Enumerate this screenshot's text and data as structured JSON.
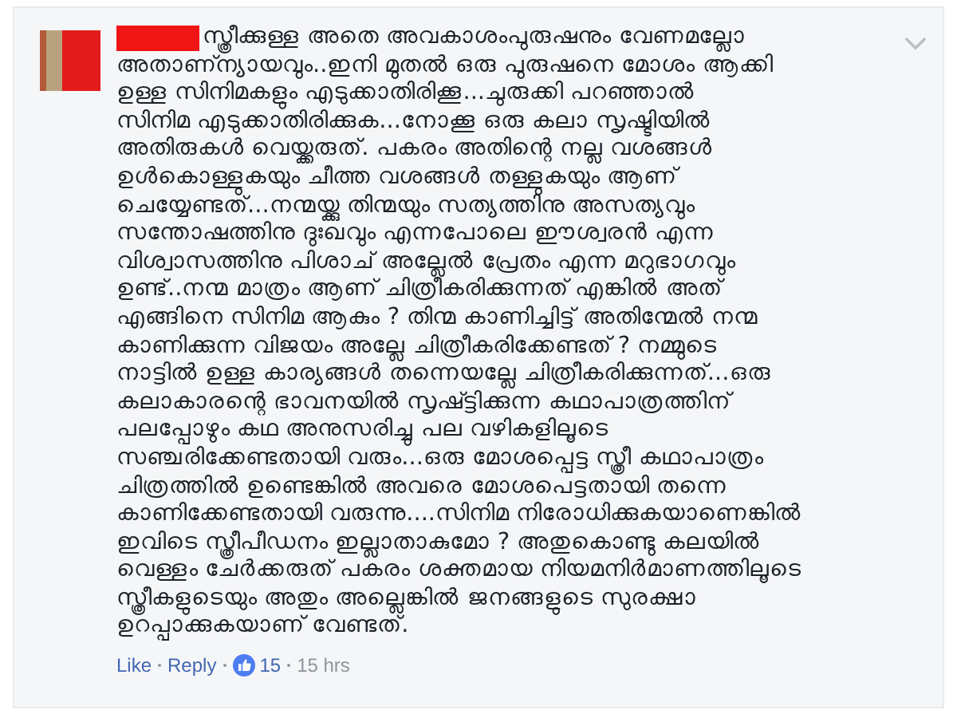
{
  "comment": {
    "author_redacted": true,
    "text": "സ്ത്രീക്കുള്ള അതെ അവകാശംപുരുഷനും വേണമല്ലോ\nഅതാണ്ന്യായവും..ഇനി മുതൽ ഒരു പുരുഷനെ മോശം ആക്കി\nഉള്ള സിനിമകളും എടുക്കാതിരിക്കൂ...ചുരുക്കി പറഞ്ഞാൽ\nസിനിമ എടുക്കാതിരിക്കുക...നോക്കൂ ഒരു കലാ സൃഷ്ടിയിൽ\nഅതിരുകൾ വെയ്ക്കരുത്. പകരം അതിന്റെ നല്ല വശങ്ങൾ\nഉൾകൊള്ളുകയും ചീത്ത വശങ്ങൾ തള്ളുകയും ആണ്\nചെയ്യേണ്ടത്...നന്മയ്ക്കു തിന്മയും സത്യത്തിനു അസത്യവും\nസന്തോഷത്തിനു ദുഃഖവും എന്നപോലെ ഈശ്വരൻ എന്ന\nവിശ്വാസത്തിനു പിശാച് അല്ലേൽ പ്രേതം എന്ന മറുഭാഗവും\nഉണ്ട്..നന്മ മാത്രം ആണ് ചിത്രീകരിക്കുന്നത് എങ്കിൽ അത്\nഎങ്ങിനെ സിനിമ ആകും ? തിന്മ കാണിച്ചിട്ട് അതിന്മേൽ നന്മ\nകാണിക്കുന്ന വിജയം അല്ലേ ചിത്രീകരിക്കേണ്ടത് ? നമ്മുടെ\nനാട്ടിൽ ഉള്ള കാര്യങ്ങൾ തന്നെയല്ലേ ചിത്രീകരിക്കുന്നത്...ഒരു\nകലാകാരന്റെ ഭാവനയിൽ സൃഷ്ട്ടിക്കുന്ന കഥാപാത്രത്തിന്\nപലപ്പോഴും കഥ അനുസരിച്ചു പല വഴികളിലൂടെ\nസഞ്ചരിക്കേണ്ടതായി വരും...ഒരു മോശപ്പെട്ട സ്ത്രീ കഥാപാത്രം\nചിത്രത്തിൽ ഉണ്ടെങ്കിൽ അവരെ മോശപെട്ടതായി തന്നെ\nകാണിക്കേണ്ടതായി വരുന്നു....സിനിമ നിരോധിക്കുകയാണെങ്കിൽ\nഇവിടെ സ്ത്രീപീഡനം ഇല്ലാതാകുമോ ? അതുകൊണ്ടു കലയിൽ\nവെള്ളം ചേർക്കരുത് പകരം ശക്തമായ നിയമനിർമാണത്തിലൂടെ\nസ്ത്രീകളുടെയും അതും അല്ലെങ്കിൽ ജനങ്ങളുടെ സുരക്ഷാ\nഉറപ്പാക്കുകയാണ് വേണ്ടത്.",
    "actions": [
      {
        "kind": "link",
        "label": "Like"
      },
      {
        "kind": "link",
        "label": "Reply"
      },
      {
        "kind": "likes",
        "label": "15"
      },
      {
        "kind": "time",
        "label": "15 hrs"
      }
    ]
  }
}
